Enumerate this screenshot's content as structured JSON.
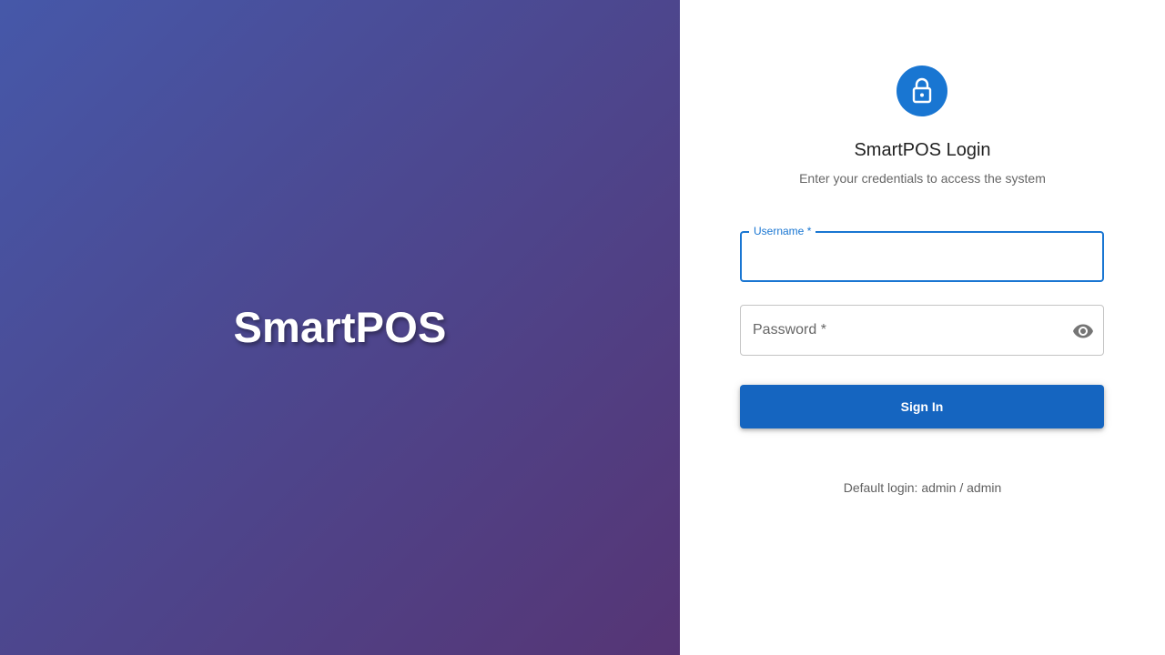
{
  "hero": {
    "brand": "SmartPOS",
    "gradient": [
      "#4658a9",
      "#4c4890",
      "#563575"
    ]
  },
  "login": {
    "icon": "lock-icon",
    "title": "SmartPOS Login",
    "subtitle": "Enter your credentials to access the system",
    "accent_color": "#1976d2",
    "username": {
      "label": "Username *",
      "value": ""
    },
    "password": {
      "label": "Password *",
      "value": "",
      "toggle_icon": "eye-icon"
    },
    "submit_label": "Sign In",
    "hint": "Default login: admin / admin"
  }
}
